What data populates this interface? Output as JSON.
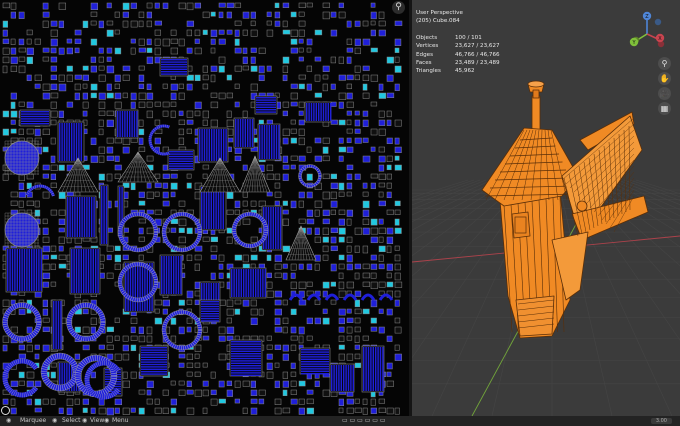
{
  "colors": {
    "uv_background": "#050505",
    "uv_island_fill": "#1f1fd9",
    "uv_wire": "#8a8a8a",
    "uv_selected_tab": "#21c8e0",
    "viewport_background": "#3b3b3b",
    "mesh_orange": "#f08a24",
    "mesh_wire": "#5a2e08",
    "axis_x": "#c8444f",
    "axis_y": "#7fbf3a",
    "axis_z": "#4f86d8"
  },
  "uv_editor": {
    "zoom_icon": "zoom-icon",
    "cursor_icon": "uv-cursor-icon"
  },
  "viewport": {
    "view_name": "User Perspective",
    "collection_object": "(205) Cube.084",
    "stats": [
      {
        "label": "Objects",
        "value": "100 / 101"
      },
      {
        "label": "Vertices",
        "value": "23,627 / 23,627"
      },
      {
        "label": "Edges",
        "value": "46,766 / 46,766"
      },
      {
        "label": "Faces",
        "value": "23,489 / 23,489"
      },
      {
        "label": "Triangles",
        "value": "45,962"
      }
    ],
    "gizmo_axes": {
      "x": "X",
      "y": "Y",
      "z": "Z"
    },
    "nav_buttons": [
      {
        "name": "zoom-button",
        "icon": "magnifier-icon",
        "glyph": "⚲"
      },
      {
        "name": "pan-button",
        "icon": "hand-icon",
        "glyph": "✋"
      },
      {
        "name": "camera-button",
        "icon": "camera-icon",
        "glyph": "🎥"
      },
      {
        "name": "perspective-button",
        "icon": "grid-icon",
        "glyph": "▦"
      }
    ]
  },
  "status_bar": {
    "items": [
      "Marquee",
      "Select",
      "View",
      "Menu"
    ],
    "version": "3.00"
  }
}
